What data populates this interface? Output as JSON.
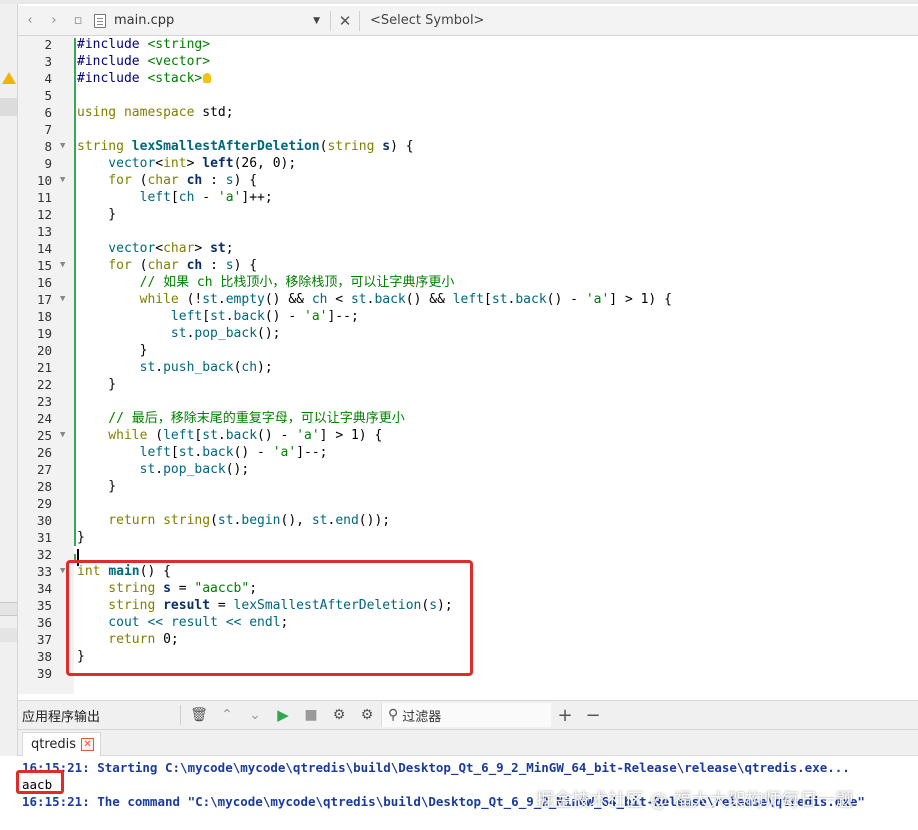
{
  "toolbar": {
    "file_name": "main.cpp",
    "symbol_placeholder": "<Select Symbol>"
  },
  "editor": {
    "lines": [
      {
        "n": "2",
        "fold": false,
        "warn": false,
        "tokens": [
          {
            "t": "#include ",
            "c": "inc"
          },
          {
            "t": "<string>",
            "c": "incp"
          }
        ]
      },
      {
        "n": "3",
        "fold": false,
        "warn": false,
        "tokens": [
          {
            "t": "#include ",
            "c": "inc"
          },
          {
            "t": "<vector>",
            "c": "incp"
          }
        ]
      },
      {
        "n": "4",
        "fold": false,
        "warn": true,
        "tokens": [
          {
            "t": "#include ",
            "c": "inc"
          },
          {
            "t": "<stack>",
            "c": "incp"
          }
        ]
      },
      {
        "n": "5",
        "fold": false,
        "warn": false,
        "tokens": []
      },
      {
        "n": "6",
        "fold": false,
        "warn": false,
        "tokens": [
          {
            "t": "using namespace ",
            "c": "kw"
          },
          {
            "t": "std;",
            "c": ""
          }
        ]
      },
      {
        "n": "7",
        "fold": false,
        "warn": false,
        "tokens": []
      },
      {
        "n": "8",
        "fold": true,
        "warn": false,
        "tokens": [
          {
            "t": "string ",
            "c": "ty"
          },
          {
            "t": "lexSmallestAfterDeletion",
            "c": "fn"
          },
          {
            "t": "(",
            "c": ""
          },
          {
            "t": "string ",
            "c": "ty"
          },
          {
            "t": "s",
            "c": "var"
          },
          {
            "t": ") {",
            "c": ""
          }
        ]
      },
      {
        "n": "9",
        "fold": false,
        "warn": false,
        "tokens": [
          {
            "t": "    vector",
            "c": "mem"
          },
          {
            "t": "<",
            "c": ""
          },
          {
            "t": "int",
            "c": "ty"
          },
          {
            "t": "> ",
            "c": ""
          },
          {
            "t": "left",
            "c": "var"
          },
          {
            "t": "(26, 0);",
            "c": ""
          }
        ]
      },
      {
        "n": "10",
        "fold": true,
        "warn": false,
        "tokens": [
          {
            "t": "    for ",
            "c": "kw"
          },
          {
            "t": "(",
            "c": ""
          },
          {
            "t": "char ",
            "c": "ty"
          },
          {
            "t": "ch",
            "c": "var"
          },
          {
            "t": " : ",
            "c": ""
          },
          {
            "t": "s",
            "c": "mem"
          },
          {
            "t": ") {",
            "c": ""
          }
        ]
      },
      {
        "n": "11",
        "fold": false,
        "warn": false,
        "tokens": [
          {
            "t": "        ",
            "c": ""
          },
          {
            "t": "left",
            "c": "mem"
          },
          {
            "t": "[",
            "c": ""
          },
          {
            "t": "ch",
            "c": "mem"
          },
          {
            "t": " - ",
            "c": ""
          },
          {
            "t": "'a'",
            "c": "str"
          },
          {
            "t": "]++;",
            "c": ""
          }
        ]
      },
      {
        "n": "12",
        "fold": false,
        "warn": false,
        "tokens": [
          {
            "t": "    }",
            "c": ""
          }
        ]
      },
      {
        "n": "13",
        "fold": false,
        "warn": false,
        "tokens": []
      },
      {
        "n": "14",
        "fold": false,
        "warn": false,
        "tokens": [
          {
            "t": "    vector",
            "c": "mem"
          },
          {
            "t": "<",
            "c": ""
          },
          {
            "t": "char",
            "c": "ty"
          },
          {
            "t": "> ",
            "c": ""
          },
          {
            "t": "st",
            "c": "var"
          },
          {
            "t": ";",
            "c": ""
          }
        ]
      },
      {
        "n": "15",
        "fold": true,
        "warn": false,
        "tokens": [
          {
            "t": "    for ",
            "c": "kw"
          },
          {
            "t": "(",
            "c": ""
          },
          {
            "t": "char ",
            "c": "ty"
          },
          {
            "t": "ch",
            "c": "var"
          },
          {
            "t": " : ",
            "c": ""
          },
          {
            "t": "s",
            "c": "mem"
          },
          {
            "t": ") {",
            "c": ""
          }
        ]
      },
      {
        "n": "16",
        "fold": false,
        "warn": false,
        "tokens": [
          {
            "t": "        // 如果 ch 比栈顶小，移除栈顶，可以让字典序更小",
            "c": "com"
          }
        ]
      },
      {
        "n": "17",
        "fold": true,
        "warn": false,
        "tokens": [
          {
            "t": "        while ",
            "c": "kw"
          },
          {
            "t": "(!",
            "c": ""
          },
          {
            "t": "st",
            "c": "mem"
          },
          {
            "t": ".",
            "c": ""
          },
          {
            "t": "empty",
            "c": "fnc"
          },
          {
            "t": "() && ",
            "c": ""
          },
          {
            "t": "ch",
            "c": "mem"
          },
          {
            "t": " < ",
            "c": ""
          },
          {
            "t": "st",
            "c": "mem"
          },
          {
            "t": ".",
            "c": ""
          },
          {
            "t": "back",
            "c": "fnc"
          },
          {
            "t": "() && ",
            "c": ""
          },
          {
            "t": "left",
            "c": "mem"
          },
          {
            "t": "[",
            "c": ""
          },
          {
            "t": "st",
            "c": "mem"
          },
          {
            "t": ".",
            "c": ""
          },
          {
            "t": "back",
            "c": "fnc"
          },
          {
            "t": "() - ",
            "c": ""
          },
          {
            "t": "'a'",
            "c": "str"
          },
          {
            "t": "] > 1) {",
            "c": ""
          }
        ]
      },
      {
        "n": "18",
        "fold": false,
        "warn": false,
        "tokens": [
          {
            "t": "            ",
            "c": ""
          },
          {
            "t": "left",
            "c": "mem"
          },
          {
            "t": "[",
            "c": ""
          },
          {
            "t": "st",
            "c": "mem"
          },
          {
            "t": ".",
            "c": ""
          },
          {
            "t": "back",
            "c": "fnc"
          },
          {
            "t": "() - ",
            "c": ""
          },
          {
            "t": "'a'",
            "c": "str"
          },
          {
            "t": "]--;",
            "c": ""
          }
        ]
      },
      {
        "n": "19",
        "fold": false,
        "warn": false,
        "tokens": [
          {
            "t": "            ",
            "c": ""
          },
          {
            "t": "st",
            "c": "mem"
          },
          {
            "t": ".",
            "c": ""
          },
          {
            "t": "pop_back",
            "c": "fnc"
          },
          {
            "t": "();",
            "c": ""
          }
        ]
      },
      {
        "n": "20",
        "fold": false,
        "warn": false,
        "tokens": [
          {
            "t": "        }",
            "c": ""
          }
        ]
      },
      {
        "n": "21",
        "fold": false,
        "warn": false,
        "tokens": [
          {
            "t": "        ",
            "c": ""
          },
          {
            "t": "st",
            "c": "mem"
          },
          {
            "t": ".",
            "c": ""
          },
          {
            "t": "push_back",
            "c": "fnc"
          },
          {
            "t": "(",
            "c": ""
          },
          {
            "t": "ch",
            "c": "mem"
          },
          {
            "t": ");",
            "c": ""
          }
        ]
      },
      {
        "n": "22",
        "fold": false,
        "warn": false,
        "tokens": [
          {
            "t": "    }",
            "c": ""
          }
        ]
      },
      {
        "n": "23",
        "fold": false,
        "warn": false,
        "tokens": []
      },
      {
        "n": "24",
        "fold": false,
        "warn": false,
        "tokens": [
          {
            "t": "    // 最后，移除末尾的重复字母，可以让字典序更小",
            "c": "com"
          }
        ]
      },
      {
        "n": "25",
        "fold": true,
        "warn": false,
        "tokens": [
          {
            "t": "    while ",
            "c": "kw"
          },
          {
            "t": "(",
            "c": ""
          },
          {
            "t": "left",
            "c": "mem"
          },
          {
            "t": "[",
            "c": ""
          },
          {
            "t": "st",
            "c": "mem"
          },
          {
            "t": ".",
            "c": ""
          },
          {
            "t": "back",
            "c": "fnc"
          },
          {
            "t": "() - ",
            "c": ""
          },
          {
            "t": "'a'",
            "c": "str"
          },
          {
            "t": "] > 1) {",
            "c": ""
          }
        ]
      },
      {
        "n": "26",
        "fold": false,
        "warn": false,
        "tokens": [
          {
            "t": "        ",
            "c": ""
          },
          {
            "t": "left",
            "c": "mem"
          },
          {
            "t": "[",
            "c": ""
          },
          {
            "t": "st",
            "c": "mem"
          },
          {
            "t": ".",
            "c": ""
          },
          {
            "t": "back",
            "c": "fnc"
          },
          {
            "t": "() - ",
            "c": ""
          },
          {
            "t": "'a'",
            "c": "str"
          },
          {
            "t": "]--;",
            "c": ""
          }
        ]
      },
      {
        "n": "27",
        "fold": false,
        "warn": false,
        "tokens": [
          {
            "t": "        ",
            "c": ""
          },
          {
            "t": "st",
            "c": "mem"
          },
          {
            "t": ".",
            "c": ""
          },
          {
            "t": "pop_back",
            "c": "fnc"
          },
          {
            "t": "();",
            "c": ""
          }
        ]
      },
      {
        "n": "28",
        "fold": false,
        "warn": false,
        "tokens": [
          {
            "t": "    }",
            "c": ""
          }
        ]
      },
      {
        "n": "29",
        "fold": false,
        "warn": false,
        "tokens": []
      },
      {
        "n": "30",
        "fold": false,
        "warn": false,
        "tokens": [
          {
            "t": "    return ",
            "c": "kw"
          },
          {
            "t": "string",
            "c": "ty"
          },
          {
            "t": "(",
            "c": ""
          },
          {
            "t": "st",
            "c": "mem"
          },
          {
            "t": ".",
            "c": ""
          },
          {
            "t": "begin",
            "c": "fnc"
          },
          {
            "t": "(), ",
            "c": ""
          },
          {
            "t": "st",
            "c": "mem"
          },
          {
            "t": ".",
            "c": ""
          },
          {
            "t": "end",
            "c": "fnc"
          },
          {
            "t": "());",
            "c": ""
          }
        ]
      },
      {
        "n": "31",
        "fold": false,
        "warn": false,
        "tokens": [
          {
            "t": "}",
            "c": ""
          }
        ]
      },
      {
        "n": "32",
        "fold": false,
        "warn": false,
        "tokens": []
      },
      {
        "n": "33",
        "fold": true,
        "warn": false,
        "tokens": [
          {
            "t": "int ",
            "c": "ty"
          },
          {
            "t": "main",
            "c": "fn"
          },
          {
            "t": "() {",
            "c": ""
          }
        ]
      },
      {
        "n": "34",
        "fold": false,
        "warn": false,
        "tokens": [
          {
            "t": "    string ",
            "c": "ty"
          },
          {
            "t": "s",
            "c": "var"
          },
          {
            "t": " = ",
            "c": ""
          },
          {
            "t": "\"aaccb\"",
            "c": "str"
          },
          {
            "t": ";",
            "c": ""
          }
        ]
      },
      {
        "n": "35",
        "fold": false,
        "warn": false,
        "tokens": [
          {
            "t": "    string ",
            "c": "ty"
          },
          {
            "t": "result",
            "c": "var"
          },
          {
            "t": " = ",
            "c": ""
          },
          {
            "t": "lexSmallestAfterDeletion",
            "c": "fnc"
          },
          {
            "t": "(",
            "c": ""
          },
          {
            "t": "s",
            "c": "mem"
          },
          {
            "t": ");",
            "c": ""
          }
        ]
      },
      {
        "n": "36",
        "fold": false,
        "warn": false,
        "tokens": [
          {
            "t": "    cout",
            "c": "mem"
          },
          {
            "t": " << ",
            "c": "mem"
          },
          {
            "t": "result",
            "c": "mem"
          },
          {
            "t": " << ",
            "c": "mem"
          },
          {
            "t": "endl",
            "c": "mem"
          },
          {
            "t": ";",
            "c": ""
          }
        ]
      },
      {
        "n": "37",
        "fold": false,
        "warn": false,
        "tokens": [
          {
            "t": "    return ",
            "c": "kw"
          },
          {
            "t": "0;",
            "c": ""
          }
        ]
      },
      {
        "n": "38",
        "fold": false,
        "warn": false,
        "tokens": [
          {
            "t": "}",
            "c": ""
          }
        ]
      },
      {
        "n": "39",
        "fold": false,
        "warn": false,
        "tokens": []
      }
    ]
  },
  "output": {
    "panel_title": "应用程序输出",
    "filter_label": "过滤器",
    "tab_label": "qtredis",
    "lines": [
      "16:15:21: Starting C:\\mycode\\mycode\\qtredis\\build\\Desktop_Qt_6_9_2_MinGW_64_bit-Release\\release\\qtredis.exe...",
      "aacb",
      "16:15:21: The command \"C:\\mycode\\mycode\\qtredis\\build\\Desktop_Qt_6_9_2_MinGW_64_bit-Release\\release\\qtredis.exe\""
    ]
  },
  "watermark": "掘金技术社区 @ 福大大架构师每日一题",
  "colors": {
    "highlight_border": "#e02b2b",
    "run_green": "#2fa84f",
    "info_blue": "#1a3b9c"
  }
}
